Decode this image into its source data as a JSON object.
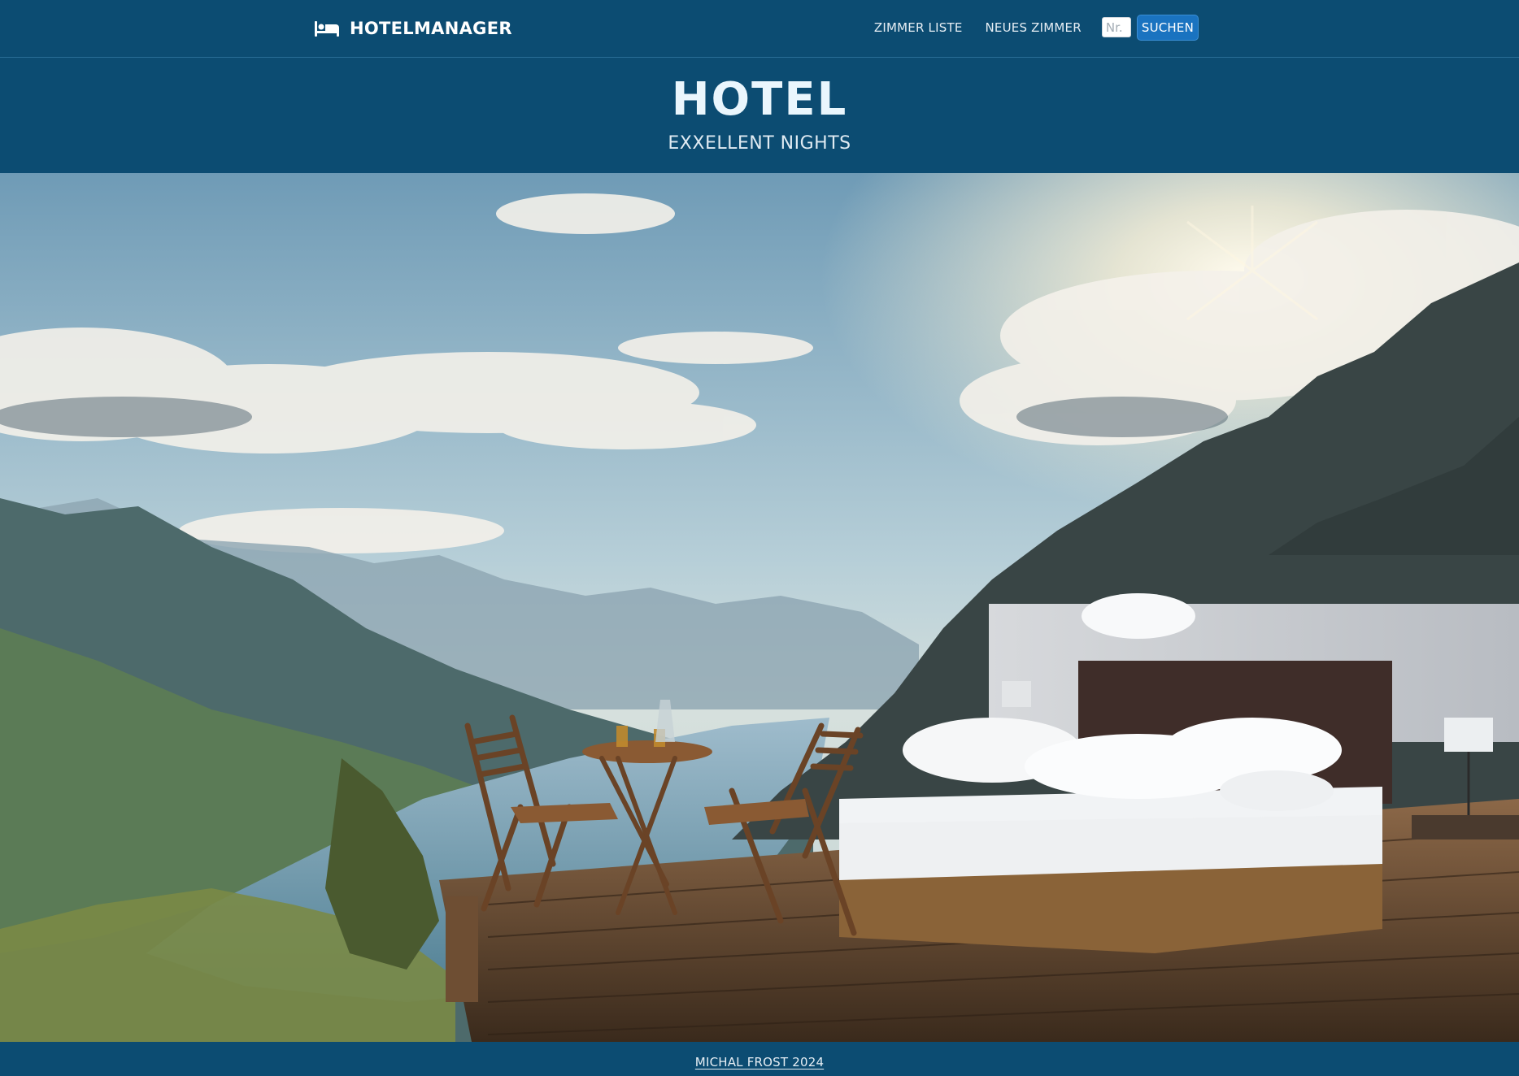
{
  "navbar": {
    "brand": "HOTELMANAGER",
    "brand_icon": "bed-icon",
    "links": [
      "ZIMMER LISTE",
      "NEUES ZIMMER"
    ],
    "search_placeholder": "Nr.",
    "search_button": "SUCHEN"
  },
  "header": {
    "title": "HOTEL",
    "subtitle": "EXXELLENT NIGHTS"
  },
  "hero": {
    "image_subject": "mountain-lake-bed-photo"
  },
  "footer": {
    "credit": "MICHAL FROST 2024"
  },
  "colors": {
    "primary": "#0c4c72",
    "button": "#1a73c0",
    "title": "#eaf6fd"
  }
}
